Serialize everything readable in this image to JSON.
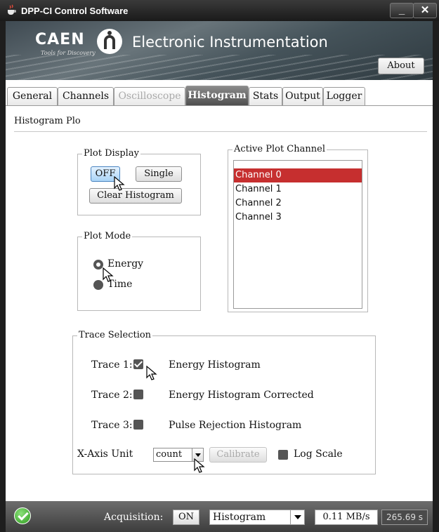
{
  "window": {
    "title": "DPP-CI Control Software",
    "minimize": "_",
    "close": "✕"
  },
  "banner": {
    "brand": "CAEN",
    "tagline": "Tools for Discovery",
    "heading": "Electronic Instrumentation",
    "about_label": "About"
  },
  "tabs": [
    {
      "label": "General",
      "state": "normal"
    },
    {
      "label": "Channels",
      "state": "normal"
    },
    {
      "label": "Oscilloscope",
      "state": "disabled"
    },
    {
      "label": "Histogram",
      "state": "active"
    },
    {
      "label": "Stats",
      "state": "normal"
    },
    {
      "label": "Output",
      "state": "normal"
    },
    {
      "label": "Logger",
      "state": "normal"
    }
  ],
  "panel": {
    "title": "Histogram Plo"
  },
  "plot_display": {
    "legend": "Plot Display",
    "off_label": "OFF",
    "single_label": "Single",
    "clear_label": "Clear Histogram"
  },
  "active_channel": {
    "legend": "Active Plot Channel",
    "items": [
      "Channel 0",
      "Channel 1",
      "Channel 2",
      "Channel 3"
    ],
    "selected": "Channel 0",
    "selected_color": "#c62f2f"
  },
  "plot_mode": {
    "legend": "Plot Mode",
    "options": [
      "Energy",
      "Time"
    ],
    "selected": "Energy"
  },
  "trace_selection": {
    "legend": "Trace Selection",
    "traces": [
      {
        "label": "Trace 1:",
        "name": "Energy Histogram",
        "checked": true
      },
      {
        "label": "Trace 2:",
        "name": "Energy Histogram Corrected",
        "checked": false
      },
      {
        "label": "Trace 3:",
        "name": "Pulse Rejection Histogram",
        "checked": false
      }
    ],
    "xaxis_label": "X-Axis Unit",
    "xaxis_value": "count",
    "calibrate_label": "Calibrate",
    "log_scale_label": "Log Scale",
    "log_scale_checked": false
  },
  "status": {
    "acquisition_label": "Acquisition:",
    "acquisition_button": "ON",
    "mode_value": "Histogram",
    "rate": "0.11 MB/s",
    "elapsed": "265.69 s"
  }
}
